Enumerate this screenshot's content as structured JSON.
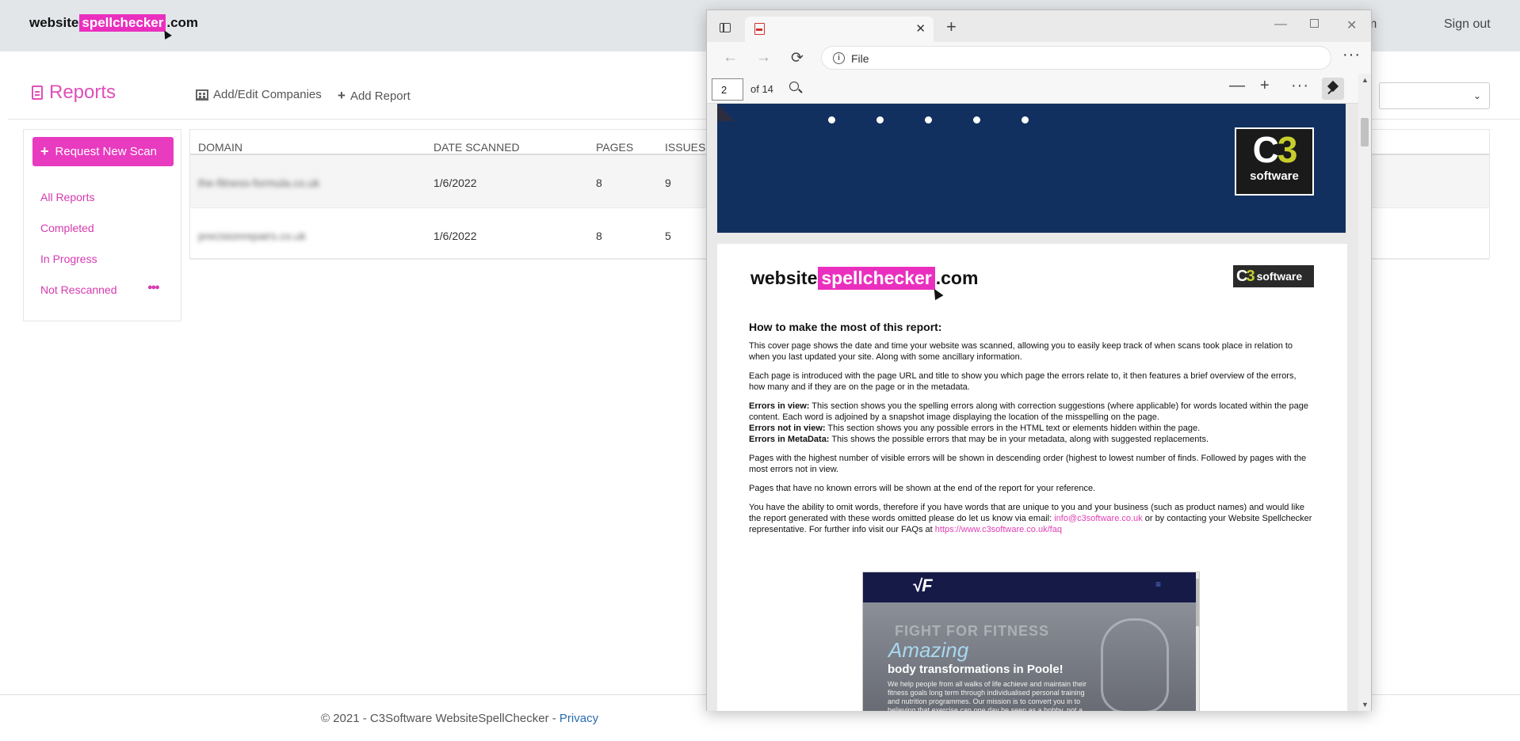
{
  "app": {
    "logo": {
      "part1": "website",
      "part2": "spellchecker",
      "part3": ".com"
    },
    "nav": {
      "account_fragment": "m",
      "sign_out": "Sign out"
    },
    "page_title": "Reports",
    "toolbar": {
      "companies": "Add/Edit Companies",
      "add_report": "Add Report"
    },
    "select": {
      "chevron": "⌄"
    },
    "sidebar": {
      "request_scan": "Request New Scan",
      "items": [
        {
          "label": "All Reports"
        },
        {
          "label": "Completed"
        },
        {
          "label": "In Progress"
        },
        {
          "label": "Not Rescanned"
        }
      ]
    },
    "table": {
      "columns": [
        "DOMAIN",
        "DATE SCANNED",
        "PAGES",
        "ISSUES"
      ],
      "rows": [
        {
          "domain": "the-fitness-formula.co.uk",
          "date": "1/6/2022",
          "pages": "8",
          "issues": "9"
        },
        {
          "domain": "precisionrepairs.co.uk",
          "date": "1/6/2022",
          "pages": "8",
          "issues": "5"
        }
      ]
    },
    "footer": {
      "text": "© 2021 - C3Software WebsiteSpellChecker - ",
      "privacy": "Privacy"
    }
  },
  "browser": {
    "tab_close": "✕",
    "new_tab": "+",
    "window_controls": {
      "minimize": "—",
      "close": "✕"
    },
    "nav": {
      "back": "←",
      "forward": "→",
      "reload": "⟳"
    },
    "address": "File",
    "more": "···",
    "pdf": {
      "current_page": "2",
      "total": "of 14",
      "zoom_out": "—",
      "zoom_in": "+",
      "more": "···"
    }
  },
  "pdf_content": {
    "c3": {
      "c": "C",
      "three": "3",
      "word": "software"
    },
    "logo": {
      "part1": "website",
      "part2": "spellchecker",
      "part3": ".com"
    },
    "heading": "How to make the most of this report:",
    "para1": "This cover page shows the date and time your website was scanned, allowing you to easily keep track of when scans took place in relation to when you last updated your site. Along with some ancillary information.",
    "para2": "Each page is introduced with the page URL and title to show you which page the errors relate to, it then features a brief overview of the errors, how many and if they are on the page or in the metadata.",
    "errors_in_view_label": "Errors in view:",
    "errors_in_view_text": " This section shows you the spelling errors along with correction suggestions (where applicable) for words located within the page content. Each word is adjoined by a snapshot image displaying the location of the misspelling on the page.",
    "errors_not_in_view_label": "Errors not in view:",
    "errors_not_in_view_text": " This section shows you any possible errors in the HTML text or elements hidden within the page.",
    "errors_meta_label": "Errors in MetaData:",
    "errors_meta_text": " This shows the possible errors that may be in your metadata, along with suggested replacements.",
    "para4": "Pages with the highest number of visible errors will be shown in descending order (highest to lowest number of finds. Followed by pages with the most errors not in view.",
    "para5": "Pages that have no known errors will be shown at the end of the report for your reference.",
    "para6_a": "You have the ability to omit words, therefore if you have words that are unique to you and your business (such as product names) and would like the report generated with these words omitted please do let us know via email: ",
    "email": "info@c3software.co.uk",
    "para6_b": " or by contacting your Website Spellchecker representative. For further info visit our FAQs at ",
    "faq_url": "https://www.c3software.co.uk/faq",
    "screenshot": {
      "logo": "√F",
      "menu": "≡",
      "fight": "FIGHT FOR FITNESS",
      "amazing": "Amazing",
      "title": "body transformations in Poole!",
      "text": "We help people from all walks of life achieve and maintain their fitness goals long term through individualised personal training and nutrition programmes. Our mission is to convert you in to believing that exercise can one day be seen as a hobby, not a"
    }
  },
  "colors": {
    "brand_pink": "#ea2fbf",
    "link_pink": "#d63ab0",
    "navy": "#12305f",
    "c3_yellow": "#c7cd2c"
  }
}
